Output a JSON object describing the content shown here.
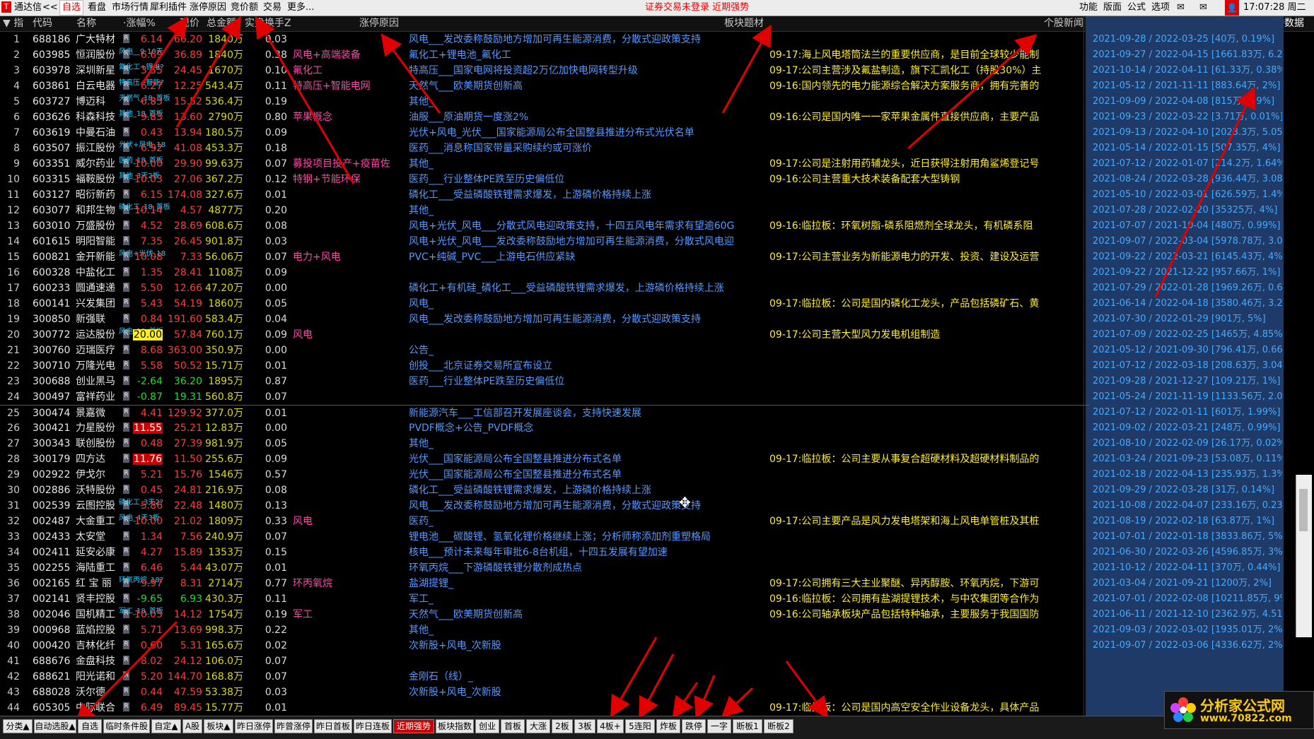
{
  "topbar": {
    "app_name": "通达信",
    "nav_back": "<<",
    "menu": [
      "自选",
      "看盘",
      "市场行情",
      "犀利插件",
      "涨停原因",
      "竞价额",
      "交易",
      "更多..."
    ],
    "alert": "证券交易未登录  近期强势",
    "right_menu": [
      "功能",
      "版面",
      "公式",
      "选项"
    ],
    "time": "17:07:28 周二"
  },
  "headers": {
    "index": "▼ 指",
    "code": "代码",
    "name": "名称",
    "chg": "·涨幅%",
    "price": "现价",
    "amount": "总金额",
    "turnover": "实盘换手Z",
    "reason": "涨停原因",
    "concept": "板块题材",
    "news": "个股新闻",
    "reduction": "减持数据"
  },
  "rows": [
    {
      "idx": "1",
      "code": "688186",
      "name": "广大特材",
      "chg": "6.14",
      "price": "66.20",
      "amount": "1840万",
      "turn": "0.03",
      "reason": "",
      "concept": "风电___发改委称鼓励地方增加可再生能源消费，分散式迎政策支持",
      "news_date": "",
      "news": "",
      "reduce": "2021-09-28 / 2022-03-25 [40万, 0.19%]"
    },
    {
      "idx": "2",
      "code": "603985",
      "name": "恒润股份",
      "tag": "风电__9-10天",
      "chg": "6.69",
      "price": "36.89",
      "amount": "1840万",
      "turn": "0.38",
      "reason": "风电+高端装备",
      "concept": "氟化工+锂电池_氟化工",
      "news_date": "09-17:",
      "news": "海上风电塔筒法兰的重要供应商，是目前全球较少能制",
      "reduce": "2021-09-27 / 2022-04-15 [1661.83万, 6.24%]"
    },
    {
      "idx": "3",
      "code": "603978",
      "name": "深圳新星",
      "tag": "氟化工+锂电?",
      "chg": "3.55",
      "price": "24.45",
      "amount": "1670万",
      "turn": "0.10",
      "reason": "氟化工",
      "concept": "特高压___国家电网将投资超2万亿加快电网转型升级",
      "news_date": "09-17:",
      "news": "公司主营涉及氟盐制造，旗下汇凯化工（持股30%）主",
      "reduce": "2021-10-14 / 2022-04-11 [61.33万, 0.38%]"
    },
    {
      "idx": "4",
      "code": "603861",
      "name": "白云电器",
      "tag": "特高压+智能?",
      "chg": "6.27",
      "price": "12.25",
      "amount": "543.4万",
      "turn": "0.11",
      "reason": "特高压+智能电网",
      "concept": "天然气___欧美期货创新高",
      "news_date": "09-16:",
      "news": "国内领先的电力能源综合解决方案服务商，拥有完善的",
      "reduce": "2021-05-12 / 2021-11-11 [883.64万, 2%]"
    },
    {
      "idx": "5",
      "code": "603727",
      "name": "博迈科",
      "tag": "天然气_18_首板",
      "chg": "6.83",
      "price": "15.52",
      "amount": "536.4万",
      "turn": "0.19",
      "reason": "",
      "concept": "其他_",
      "news_date": "",
      "news": "",
      "reduce": "2021-09-09 / 2022-04-08 [815万, 2.9%]"
    },
    {
      "idx": "6",
      "code": "603626",
      "name": "科森科技",
      "tag": "其他_18_首板",
      "chg": "9.83",
      "price": "13.60",
      "amount": "2790万",
      "turn": "0.80",
      "reason": "苹果概念",
      "concept": "油服___原油期货一度涨2%",
      "news_date": "09-16:",
      "news": "公司是国内唯一一家苹果金属件直接供应商，主要产品",
      "reduce": "2021-09-23 / 2022-03-22 [3.71万, 0.01%]"
    },
    {
      "idx": "7",
      "code": "603619",
      "name": "中曼石油",
      "chg": "0.43",
      "price": "13.94",
      "amount": "180.5万",
      "turn": "0.09",
      "reason": "",
      "concept": "光伏+风电_光伏___国家能源局公布全国整县推进分布式光伏名单",
      "news_date": "",
      "news": "",
      "reduce": "2021-09-13 / 2022-04-10 [2023.3万, 5.05%]"
    },
    {
      "idx": "8",
      "code": "603507",
      "name": "振江股份",
      "tag": "光伏+风电_18",
      "chg": "6.92",
      "price": "41.08",
      "amount": "453.3万",
      "turn": "0.18",
      "reason": "",
      "concept": "医药___消息称国家带量采购续约或可涨价",
      "news_date": "",
      "news": "",
      "reduce": "2021-05-14 / 2022-01-15 [507.35万, 4%]"
    },
    {
      "idx": "9",
      "code": "603351",
      "name": "威尔药业",
      "tag": "医药_18_首板",
      "chg": "10.00",
      "price": "29.90",
      "amount": "99.63万",
      "turn": "0.07",
      "reason": "募投项目投产+疫苗佐",
      "concept": "其他_",
      "news_date": "09-17:",
      "news": "公司是注射用药辅龙头，近日获得注射用角鲨烯登记号",
      "reduce": "2021-07-12 / 2022-01-07 [214.2万, 1.64%]"
    },
    {
      "idx": "10",
      "code": "603315",
      "name": "福鞍股份",
      "tag": "其他_3天2板",
      "chg": "10.03",
      "price": "27.06",
      "amount": "367.2万",
      "turn": "0.12",
      "reason": "特钢+节能环保",
      "concept": "医药___行业整体PE跌至历史偏低位",
      "news_date": "09-16:",
      "news": "公司主营重大技术装备配套大型铸钢",
      "reduce": "2021-08-24 / 2022-03-28 [936.44万, 3.08%]"
    },
    {
      "idx": "11",
      "code": "603127",
      "name": "昭衍新药",
      "chg": "6.15",
      "price": "174.08",
      "amount": "327.6万",
      "turn": "0.01",
      "reason": "",
      "concept": "磷化工___受益磷酸铁锂需求爆发，上游磷价格持续上涨",
      "news_date": "",
      "news": "",
      "reduce": "2021-05-10 / 2022-03-01 [626.59万, 1.4%]"
    },
    {
      "idx": "12",
      "code": "603077",
      "name": "和邦生物",
      "tag": "磷化工_18_首板",
      "chg": "10.14",
      "price": "4.57",
      "amount": "4877万",
      "turn": "0.20",
      "reason": "",
      "concept": "其他_",
      "news_date": "",
      "news": "",
      "reduce": "2021-07-28 / 2022-02-20 [35325万, 4%]"
    },
    {
      "idx": "13",
      "code": "603010",
      "name": "万盛股份",
      "chg": "4.52",
      "price": "28.69",
      "amount": "608.6万",
      "turn": "0.08",
      "reason": "",
      "concept": "风电+光伏_风电___分散式风电迎政策支持，十四五风电年需求有望逾60G",
      "news_date": "09-16:",
      "news": "临拉板：环氧树脂-磷系阻燃剂全球龙头，有机磷系阻",
      "reduce": "2021-07-07 / 2021-10-04 [480万, 0.99%]"
    },
    {
      "idx": "14",
      "code": "601615",
      "name": "明阳智能",
      "chg": "7.35",
      "price": "26.45",
      "amount": "901.8万",
      "turn": "0.03",
      "reason": "",
      "concept": "风电+光伏_风电___发改委称鼓励地方增加可再生能源消费，分散式风电迎",
      "news_date": "",
      "news": "",
      "reduce": "2021-09-07 / 2022-03-04 [5978.78万, 3.08%]"
    },
    {
      "idx": "15",
      "code": "600821",
      "name": "金开新能",
      "tag": "风电+光伏_18",
      "chg": "10.08",
      "price": "7.33",
      "amount": "56.06万",
      "turn": "0.07",
      "reason": "电力+风电",
      "concept": "PVC+纯碱_PVC___上游电石供应紧缺",
      "news_date": "09-17:",
      "news": "公司主营业务为新能源电力的开发、投资、建设及运营",
      "reduce": "2021-09-22 / 2022-03-21 [6145.43万, 4%]"
    },
    {
      "idx": "16",
      "code": "600328",
      "name": "中盐化工",
      "chg": "1.35",
      "price": "28.41",
      "amount": "1108万",
      "turn": "0.09",
      "reason": "",
      "concept": "",
      "news_date": "",
      "news": "",
      "reduce": "2021-09-22 / 2021-12-22 [957.66万, 1%]"
    },
    {
      "idx": "17",
      "code": "600233",
      "name": "圆通速递",
      "chg": "5.50",
      "price": "12.66",
      "amount": "47.20万",
      "turn": "0.00",
      "reason": "",
      "concept": "磷化工+有机硅_磷化工___受益磷酸铁锂需求爆发，上游磷价格持续上涨",
      "news_date": "",
      "news": "",
      "reduce": "2021-07-29 / 2022-01-28 [1969.26万, 0.62%]"
    },
    {
      "idx": "18",
      "code": "600141",
      "name": "兴发集团",
      "chg": "5.43",
      "price": "54.19",
      "amount": "1860万",
      "turn": "0.05",
      "reason": "",
      "concept": "风电_",
      "news_date": "09-17:",
      "news": "临拉板：公司是国内磷化工龙头，产品包括磷矿石、黄",
      "reduce": "2021-06-14 / 2022-04-18 [3580.46万, 3.2%]"
    },
    {
      "idx": "19",
      "code": "300850",
      "name": "新强联",
      "chg": "0.84",
      "price": "191.60",
      "amount": "583.4万",
      "turn": "0.04",
      "reason": "",
      "concept": "风电___发改委称鼓励地方增加可再生能源消费，分散式迎政策支持",
      "news_date": "",
      "news": "",
      "reduce": "2021-07-30 / 2022-01-29 [901万, 5%]"
    },
    {
      "idx": "20",
      "code": "300772",
      "name": "运达股份",
      "tag": "风电_18_首板",
      "chg": "20.00",
      "price": "57.84",
      "amount": "760.1万",
      "turn": "0.09",
      "reason": "风电",
      "concept": "",
      "news_date": "09-17:",
      "news": "公司主营大型风力发电机组制造",
      "reduce": "2021-07-09 / 2022-02-25 [1465万, 4.85%]"
    },
    {
      "idx": "21",
      "code": "300760",
      "name": "迈瑞医疗",
      "chg": "8.68",
      "price": "363.00",
      "amount": "350.9万",
      "turn": "0.00",
      "reason": "",
      "concept": "公告_",
      "news_date": "",
      "news": "",
      "reduce": "2021-05-12 / 2021-09-30 [796.41万, 0.66%]"
    },
    {
      "idx": "22",
      "code": "300710",
      "name": "万隆光电",
      "chg": "5.58",
      "price": "50.52",
      "amount": "15.71万",
      "turn": "0.01",
      "reason": "",
      "concept": "创投___北京证券交易所宣布设立",
      "news_date": "",
      "news": "",
      "reduce": "2021-07-12 / 2022-03-18 [208.63万, 3.04%]"
    },
    {
      "idx": "23",
      "code": "300688",
      "name": "创业黑马",
      "chg": "-2.64",
      "price": "36.20",
      "amount": "1895万",
      "turn": "0.87",
      "reason": "",
      "concept": "医药___行业整体PE跌至历史偏低位",
      "news_date": "",
      "news": "",
      "reduce": "2021-09-28 / 2021-12-27 [109.21万, 1%]"
    },
    {
      "idx": "24",
      "code": "300497",
      "name": "富祥药业",
      "chg": "-0.87",
      "price": "19.31",
      "amount": "560.8万",
      "turn": "0.07",
      "reason": "",
      "concept": "",
      "news_date": "",
      "news": "",
      "reduce": "2021-05-24 / 2021-11-19 [1133.56万, 2.06%]"
    },
    {
      "idx": "25",
      "code": "300474",
      "name": "景嘉微",
      "chg": "4.41",
      "price": "129.92",
      "amount": "377.0万",
      "turn": "0.01",
      "reason": "",
      "concept": "新能源汽车___工信部召开发展座谈会，支持快速发展",
      "news_date": "",
      "news": "",
      "reduce": "2021-07-12 / 2022-01-11 [601万, 1.99%]"
    },
    {
      "idx": "26",
      "code": "300421",
      "name": "力星股份",
      "chg": "11.55",
      "price": "25.21",
      "amount": "12.83万",
      "turn": "0.00",
      "reason": "",
      "concept": "PVDF概念+公告_PVDF概念",
      "news_date": "",
      "news": "",
      "reduce": "2021-09-02 / 2022-03-21 [248万, 0.99%]"
    },
    {
      "idx": "27",
      "code": "300343",
      "name": "联创股份",
      "chg": "0.48",
      "price": "27.39",
      "amount": "981.9万",
      "turn": "0.05",
      "reason": "",
      "concept": "其他_",
      "news_date": "",
      "news": "",
      "reduce": "2021-08-10 / 2022-02-09 [26.17万, 0.02%]"
    },
    {
      "idx": "28",
      "code": "300179",
      "name": "四方达",
      "chg": "11.76",
      "price": "11.50",
      "amount": "255.6万",
      "turn": "0.09",
      "reason": "",
      "concept": "光伏___国家能源局公布全国整县推进分布式名单",
      "news_date": "09-17:",
      "news": "临拉板：公司主要从事复合超硬材料及超硬材料制品的",
      "reduce": "2021-03-24 / 2021-09-23 [53.08万, 0.11%]"
    },
    {
      "idx": "29",
      "code": "002922",
      "name": "伊戈尔",
      "chg": "5.21",
      "price": "15.76",
      "amount": "1546万",
      "turn": "0.57",
      "reason": "",
      "concept": "光伏___国家能源局公布全国整县推进分布式名单",
      "news_date": "",
      "news": "",
      "reduce": "2021-02-18 / 2022-04-13 [235.93万, 1.3%]"
    },
    {
      "idx": "30",
      "code": "002886",
      "name": "沃特股份",
      "chg": "0.45",
      "price": "24.81",
      "amount": "216.9万",
      "turn": "0.08",
      "reason": "",
      "concept": "磷化工___受益磷酸铁锂需求爆发，上游磷价格持续上涨",
      "news_date": "",
      "news": "",
      "reduce": "2021-09-29 / 2022-03-28 [31万, 0.14%]"
    },
    {
      "idx": "31",
      "code": "002539",
      "name": "云图控股",
      "tag": "磷化工_3天2?",
      "chg": "5.86",
      "price": "22.48",
      "amount": "1480万",
      "turn": "0.13",
      "reason": "",
      "concept": "风电___发改委称鼓励地方增加可再生能源消费，分散式迎政策支持",
      "news_date": "",
      "news": "",
      "reduce": "2021-10-08 / 2022-04-07 [233.16万, 0.23%]"
    },
    {
      "idx": "32",
      "code": "002487",
      "name": "大金重工",
      "tag": "风电_4天3板",
      "chg": "10.00",
      "price": "21.02",
      "amount": "1809万",
      "turn": "0.33",
      "reason": "风电",
      "concept": "医药_",
      "news_date": "09-17:",
      "news": "公司主要产品是风力发电塔架和海上风电单管桩及其桩",
      "reduce": "2021-08-19 / 2022-02-18 [63.87万, 1%]"
    },
    {
      "idx": "33",
      "code": "002433",
      "name": "太安堂",
      "chg": "1.34",
      "price": "7.56",
      "amount": "240.9万",
      "turn": "0.07",
      "reason": "",
      "concept": "锂电池___碳酸锂、氢氧化锂价格继续上涨；分析师称添加剂重塑格局",
      "news_date": "",
      "news": "",
      "reduce": "2021-07-01 / 2022-01-18 [3833.86万, 5%]"
    },
    {
      "idx": "34",
      "code": "002411",
      "name": "延安必康",
      "chg": "4.27",
      "price": "15.89",
      "amount": "1353万",
      "turn": "0.15",
      "reason": "",
      "concept": "核电___预计未来每年审批6-8台机组，十四五发展有望加速",
      "news_date": "",
      "news": "",
      "reduce": "2021-06-30 / 2022-03-26 [4596.85万, 3%]"
    },
    {
      "idx": "35",
      "code": "002255",
      "name": "海陆重工",
      "chg": "6.46",
      "price": "5.44",
      "amount": "43.07万",
      "turn": "0.01",
      "reason": "",
      "concept": "环氧丙烷___下游磷酸铁锂分散剂成热点",
      "news_date": "",
      "news": "",
      "reduce": "2021-10-12 / 2022-04-11 [370万, 0.44%]"
    },
    {
      "idx": "36",
      "code": "002165",
      "name": "红 宝 丽",
      "tag": "环氧丙烷_18?",
      "chg": "9.97",
      "price": "8.31",
      "amount": "2714万",
      "turn": "0.77",
      "reason": "环丙氧烷",
      "concept": "盐湖提锂_",
      "news_date": "09-17:",
      "news": "公司拥有三大主业聚醚、异丙醇胺、环氧丙烷，下游可",
      "reduce": "2021-03-04 / 2021-09-21 [1200万, 2%]"
    },
    {
      "idx": "37",
      "code": "002141",
      "name": "贤丰控股",
      "chg": "-9.65",
      "price": "6.93",
      "amount": "430.3万",
      "turn": "0.11",
      "reason": "",
      "concept": "军工_",
      "news_date": "09-16:",
      "news": "临拉板：公司拥有盐湖提锂技术，与中农集团等合作为",
      "reduce": "2021-07-01 / 2022-02-08 [10211.85万, 9%]"
    },
    {
      "idx": "38",
      "code": "002046",
      "name": "国机精工",
      "tag": "军工_18_首板",
      "chg": "10.05",
      "price": "14.12",
      "amount": "1754万",
      "turn": "0.19",
      "reason": "军工",
      "concept": "天然气___欧美期货创新高",
      "news_date": "09-16:",
      "news": "公司轴承板块产品包括特种轴承，主要服务于我国国防",
      "reduce": "2021-06-11 / 2021-12-10 [2362.9万, 4.51%]"
    },
    {
      "idx": "39",
      "code": "000968",
      "name": "蓝焰控股",
      "chg": "5.71",
      "price": "13.69",
      "amount": "998.3万",
      "turn": "0.22",
      "reason": "",
      "concept": "其他_",
      "news_date": "",
      "news": "",
      "reduce": "2021-09-03 / 2022-03-02 [1935.01万, 2%]"
    },
    {
      "idx": "40",
      "code": "000420",
      "name": "吉林化纤",
      "chg": "0.60",
      "price": "5.31",
      "amount": "165.6万",
      "turn": "0.02",
      "reason": "",
      "concept": "次新股+风电_次新股",
      "news_date": "",
      "news": "",
      "reduce": "2021-09-07 / 2022-03-06 [4336.62万, 2%]"
    },
    {
      "idx": "41",
      "code": "688676",
      "name": "金盘科技",
      "chg": "8.02",
      "price": "24.12",
      "amount": "106.0万",
      "turn": "0.07",
      "reason": "",
      "concept": "",
      "news_date": "",
      "news": "",
      "reduce": ""
    },
    {
      "idx": "42",
      "code": "688621",
      "name": "阳光诺和",
      "chg": "5.20",
      "price": "144.70",
      "amount": "168.8万",
      "turn": "0.07",
      "reason": "",
      "concept": "金刚石（线）_",
      "news_date": "",
      "news": "",
      "reduce": ""
    },
    {
      "idx": "43",
      "code": "688028",
      "name": "沃尔德",
      "chg": "0.44",
      "price": "47.59",
      "amount": "53.38万",
      "turn": "0.03",
      "reason": "",
      "concept": "次新股+风电_次新股",
      "news_date": "",
      "news": "",
      "reduce": ""
    },
    {
      "idx": "44",
      "code": "605305",
      "name": "中际联合",
      "chg": "6.49",
      "price": "89.45",
      "amount": "15.77万",
      "turn": "0.01",
      "reason": "",
      "concept": "",
      "news_date": "09-17:",
      "news": "临拉板：公司是国内高空安全作业设备龙头，具体产品",
      "reduce": ""
    }
  ],
  "bottom_tabs": [
    "分类▲",
    "自动选股▲",
    "自选",
    "临时条件股",
    "自定▲",
    "A股",
    "板块▲",
    "昨日涨停",
    "昨曾涨停",
    "昨日首板",
    "昨日连板",
    "近期强势",
    "板块指数",
    "创业",
    "首板",
    "大涨",
    "2板",
    "3板",
    "4板+",
    "5连阳",
    "炸板",
    "跌停",
    "一字",
    "断板1",
    "断板2"
  ],
  "active_tab": "近期强势",
  "watermark": "分析家公式网www.70822.com",
  "logo": {
    "title": "分析家公式网",
    "url": "www.70822.com"
  },
  "colors": {
    "up": "#ff3b3b",
    "down": "#22dd22",
    "concept": "#5599ff",
    "reason": "#ff44aa",
    "news": "#ffee22",
    "reduce_panel": "#1f3a66",
    "arrow": "#e00000"
  }
}
